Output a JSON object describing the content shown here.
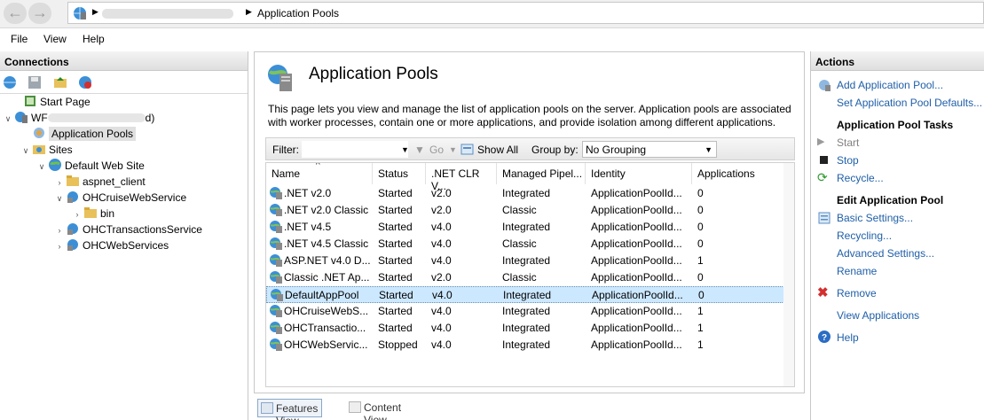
{
  "address": {
    "crumb": "Application Pools"
  },
  "menu": [
    "File",
    "View",
    "Help"
  ],
  "connections": {
    "title": "Connections",
    "tree": [
      {
        "label": "Start Page",
        "indent": 0
      },
      {
        "label": "WF",
        "suffix": "d)",
        "indent": 0
      },
      {
        "label": "Application Pools",
        "indent": 1
      },
      {
        "label": "Sites",
        "indent": 1
      },
      {
        "label": "Default Web Site",
        "indent": 2
      },
      {
        "label": "aspnet_client",
        "indent": 3
      },
      {
        "label": "OHCruiseWebService",
        "indent": 3
      },
      {
        "label": "bin",
        "indent": 4
      },
      {
        "label": "OHCTransactionsService",
        "indent": 3
      },
      {
        "label": "OHCWebServices",
        "indent": 3
      }
    ]
  },
  "main": {
    "title": "Application Pools",
    "description": "This page lets you view and manage the list of application pools on the server. Application pools are associated with worker processes, contain one or more applications, and provide isolation among different applications.",
    "filter_label": "Filter:",
    "go_label": "Go",
    "show_all_label": "Show All",
    "group_by_label": "Group by:",
    "group_by_value": "No Grouping",
    "columns": [
      "Name",
      "Status",
      ".NET CLR V...",
      "Managed Pipel...",
      "Identity",
      "Applications"
    ],
    "rows": [
      {
        "name": ".NET v2.0",
        "status": "Started",
        "clr": "v2.0",
        "pipeline": "Integrated",
        "identity": "ApplicationPoolId...",
        "apps": "0"
      },
      {
        "name": ".NET v2.0 Classic",
        "status": "Started",
        "clr": "v2.0",
        "pipeline": "Classic",
        "identity": "ApplicationPoolId...",
        "apps": "0"
      },
      {
        "name": ".NET v4.5",
        "status": "Started",
        "clr": "v4.0",
        "pipeline": "Integrated",
        "identity": "ApplicationPoolId...",
        "apps": "0"
      },
      {
        "name": ".NET v4.5 Classic",
        "status": "Started",
        "clr": "v4.0",
        "pipeline": "Classic",
        "identity": "ApplicationPoolId...",
        "apps": "0"
      },
      {
        "name": "ASP.NET v4.0 D...",
        "status": "Started",
        "clr": "v4.0",
        "pipeline": "Integrated",
        "identity": "ApplicationPoolId...",
        "apps": "1"
      },
      {
        "name": "Classic .NET Ap...",
        "status": "Started",
        "clr": "v2.0",
        "pipeline": "Classic",
        "identity": "ApplicationPoolId...",
        "apps": "0"
      },
      {
        "name": "DefaultAppPool",
        "status": "Started",
        "clr": "v4.0",
        "pipeline": "Integrated",
        "identity": "ApplicationPoolId...",
        "apps": "0",
        "selected": true
      },
      {
        "name": "OHCruiseWebS...",
        "status": "Started",
        "clr": "v4.0",
        "pipeline": "Integrated",
        "identity": "ApplicationPoolId...",
        "apps": "1"
      },
      {
        "name": "OHCTransactio...",
        "status": "Started",
        "clr": "v4.0",
        "pipeline": "Integrated",
        "identity": "ApplicationPoolId...",
        "apps": "1"
      },
      {
        "name": "OHCWebServic...",
        "status": "Stopped",
        "clr": "v4.0",
        "pipeline": "Integrated",
        "identity": "ApplicationPoolId...",
        "apps": "1"
      }
    ],
    "features_view_label": "Features View",
    "content_view_label": "Content View"
  },
  "actions": {
    "title": "Actions",
    "add_pool": "Add Application Pool...",
    "set_defaults": "Set Application Pool Defaults...",
    "tasks_header": "Application Pool Tasks",
    "start": "Start",
    "stop": "Stop",
    "recycle": "Recycle...",
    "edit_header": "Edit Application Pool",
    "basic_settings": "Basic Settings...",
    "recycling": "Recycling...",
    "advanced_settings": "Advanced Settings...",
    "rename": "Rename",
    "remove": "Remove",
    "view_applications": "View Applications",
    "help": "Help"
  },
  "colors": {
    "link": "#1f5fa8",
    "selection": "#cce8ff",
    "remove_icon": "#d32f2f"
  }
}
